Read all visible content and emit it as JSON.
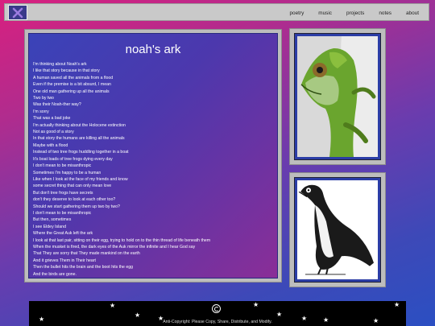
{
  "nav": {
    "logo_icon": "x-mark-icon",
    "links": [
      "poetry",
      "music",
      "projects",
      "notes",
      "about"
    ]
  },
  "poem": {
    "title": "noah's ark",
    "lines": [
      "I'm thinking about Noah's ark",
      "I like that story because in that story",
      "A human saved all the animals from a flood",
      "Even if the premise is a bit absurd, I mean",
      "One old man gathering up all the animals",
      "Two by two",
      "Was their Noah-ther way?",
      "I'm sorry",
      "That was a bad joke",
      "I'm actually thinking about the Holocene extinction",
      "Not as good of a story",
      "In that story the humans are killing all the animals",
      "Maybe with a flood",
      "Instead of two tree frogs huddling together in a boat",
      "It's boat loads of tree frogs dying every day",
      "I don't mean to be misanthropic",
      "Sometimes I'm happy to be a human",
      "Like when I look at the face of my friends and know",
      "some secret thing that can only mean love",
      "But don't tree frogs have secrets",
      "don't they deserve to look at each other too?",
      "Should we start gathering them up two by two?",
      "I don't mean to be misanthropic",
      "But then, sometimes",
      "I see Eldey Island",
      "Where the Great Auk left the ark",
      "I look at that last pair, sitting on their egg, trying to hold on to the thin thread of life beneath them",
      "When the musket is fired, the dark eyes of the Auk mirror the infinite and I hear God say",
      "That They are sorry that They made mankind on the earth",
      "And it grieves Them in Their heart",
      "Then the bullet hits the brain and the boot hits the egg",
      "And the birds are gone."
    ]
  },
  "images": {
    "frog": "tree-frog-photo",
    "auk": "great-auk-illustration"
  },
  "footer": {
    "icon": "copyleft-icon",
    "text": "Anti-Copyright: Please Copy, Share, Distribute, and Modify."
  }
}
